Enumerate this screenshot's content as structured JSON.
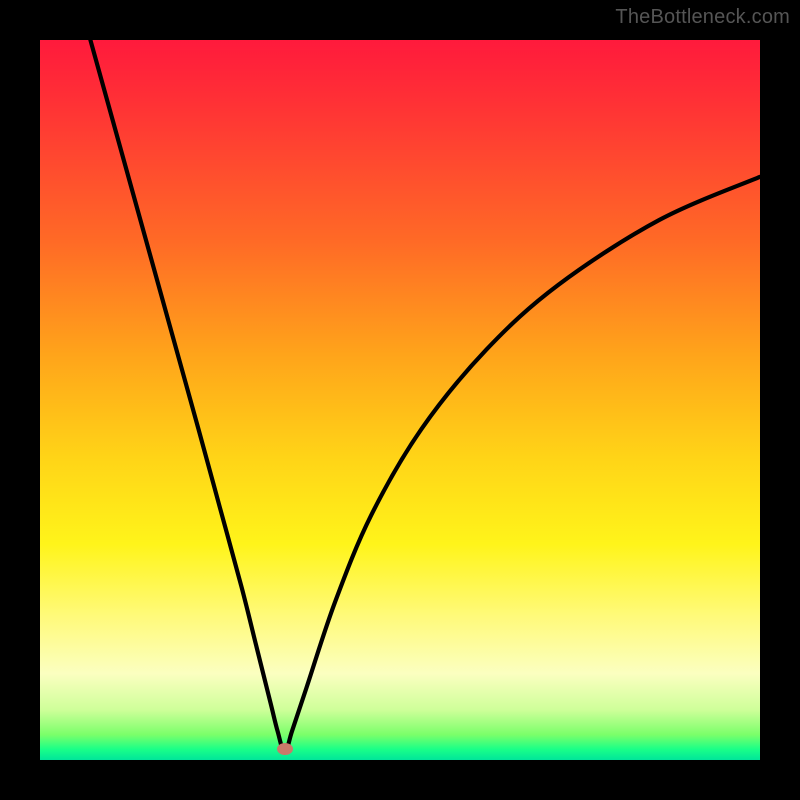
{
  "watermark": {
    "text": "TheBottleneck.com"
  },
  "chart_data": {
    "type": "line",
    "title": "",
    "xlabel": "",
    "ylabel": "",
    "xlim": [
      0,
      100
    ],
    "ylim": [
      0,
      100
    ],
    "grid": false,
    "series": [
      {
        "name": "curve",
        "x": [
          7,
          12,
          17,
          22,
          25,
          28,
          30,
          32,
          33,
          34,
          35,
          37,
          41,
          46,
          53,
          62,
          72,
          86,
          100
        ],
        "y": [
          100,
          82,
          64,
          46,
          35,
          24,
          16,
          8,
          4,
          1,
          4,
          10,
          22,
          34,
          46,
          57,
          66,
          75,
          81
        ]
      }
    ],
    "annotations": [
      {
        "type": "marker",
        "x": 34,
        "y": 1.5,
        "color": "#c97a6a"
      }
    ],
    "background_gradient": {
      "direction": "vertical",
      "stops": [
        {
          "pos": 0,
          "color": "#ff1a3c"
        },
        {
          "pos": 0.5,
          "color": "#ffd417"
        },
        {
          "pos": 0.95,
          "color": "#7aff6a"
        },
        {
          "pos": 1,
          "color": "#00e59a"
        }
      ]
    }
  }
}
